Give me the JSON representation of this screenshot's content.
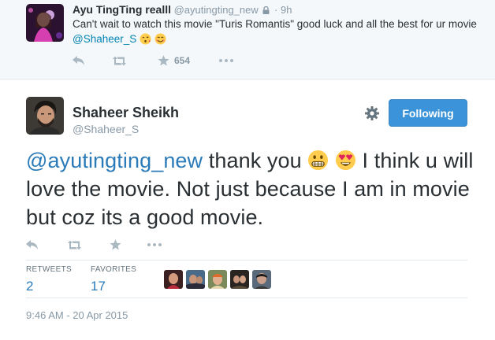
{
  "parent_tweet": {
    "name": "Ayu TingTing realll",
    "handle": "@ayutingting_new",
    "separator": "·",
    "time": "9h",
    "text_before": "Can't wait to watch this movie \"Turis Romantis\" good luck and all the best for ur movie ",
    "mention": "@Shaheer_S",
    "favorite_count": "654"
  },
  "main_tweet": {
    "name": "Shaheer Sheikh",
    "handle": "@Shaheer_S",
    "follow_label": "Following",
    "mention": "@ayutingting_new",
    "text_part1": " thank you ",
    "text_part2": " I think u will love the movie. Not just because I am in movie but coz its a good movie.",
    "retweets_label": "RETWEETS",
    "retweets_count": "2",
    "favorites_label": "FAVORITES",
    "favorites_count": "17",
    "timestamp": "9:46 AM - 20 Apr 2015"
  },
  "colors": {
    "link": "#2b7bb9",
    "follow_button": "#3b94d9",
    "muted": "#8899a6",
    "parent_background": "#f5f8fa"
  },
  "icons": [
    "lock-icon",
    "reply-icon",
    "retweet-icon",
    "favorite-icon",
    "more-icon",
    "gear-icon",
    "kiss-emoji",
    "smile-emoji",
    "grimace-emoji",
    "heart-eyes-emoji"
  ]
}
